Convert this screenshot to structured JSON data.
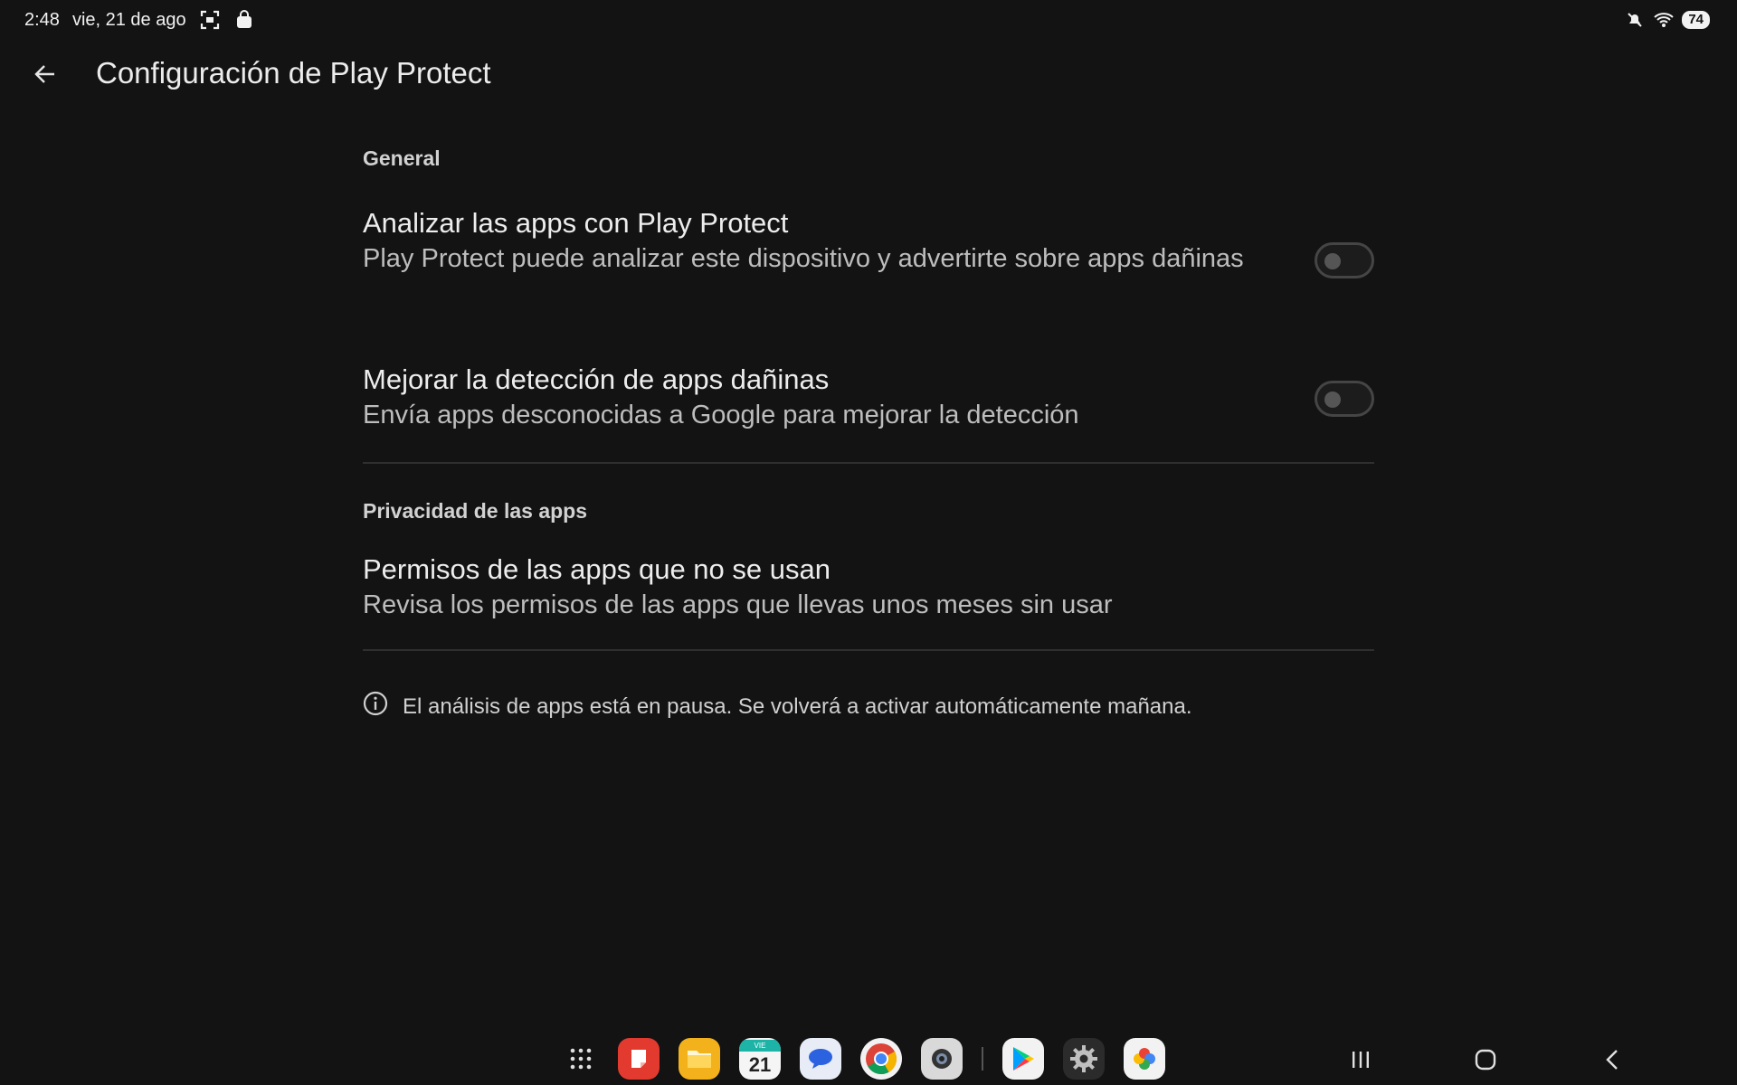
{
  "status_bar": {
    "time": "2:48",
    "date": "vie, 21 de ago",
    "battery": "74",
    "icons": [
      "screenshot-icon",
      "shopping-bag-icon",
      "mute-icon",
      "wifi-icon",
      "battery-icon"
    ]
  },
  "app_bar": {
    "title": "Configuración de Play Protect",
    "back_icon": "arrow-back-icon"
  },
  "sections": {
    "general": {
      "header": "General",
      "scan_apps": {
        "title": "Analizar las apps con Play Protect",
        "summary": "Play Protect puede analizar este dispositivo y advertirte sobre apps dañinas",
        "enabled": false
      },
      "improve_detection": {
        "title": "Mejorar la detección de apps dañinas",
        "summary": "Envía apps desconocidas a Google para mejorar la detección",
        "enabled": false
      }
    },
    "privacy": {
      "header": "Privacidad de las apps",
      "unused_permissions": {
        "title": "Permisos de las apps que no se usan",
        "summary": "Revisa los permisos de las apps que llevas unos meses sin usar"
      }
    }
  },
  "footer": {
    "info_icon": "info-icon",
    "text": "El análisis de apps está en pausa. Se volverá a activar automáticamente mañana."
  },
  "taskbar": {
    "calendar_day": "21",
    "calendar_weekday": "VIE",
    "apps": [
      "app-drawer-icon",
      "notes-app-icon",
      "files-app-icon",
      "calendar-app-icon",
      "messages-app-icon",
      "chrome-app-icon",
      "camera-app-icon",
      "play-store-app-icon",
      "settings-app-icon",
      "photos-app-icon"
    ],
    "nav": [
      "recents-icon",
      "home-icon",
      "nav-back-icon"
    ]
  },
  "colors": {
    "background": "#131313",
    "text_primary": "#ededed",
    "text_secondary": "#bdbdbd"
  }
}
